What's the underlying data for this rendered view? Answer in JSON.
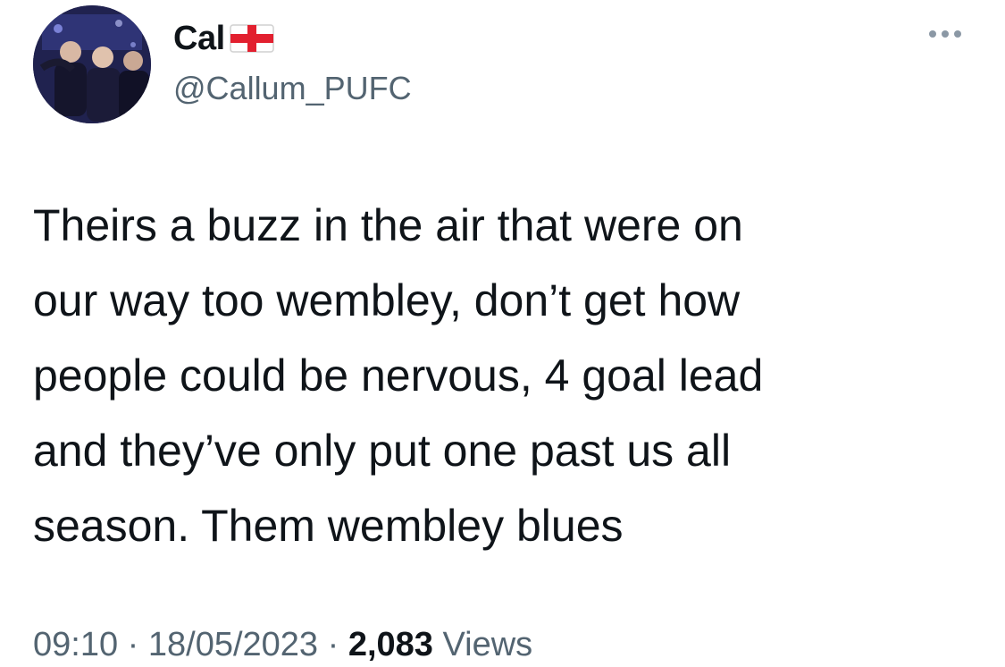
{
  "user": {
    "display_name": "Cal",
    "flag_icon": "england-flag-icon",
    "handle": "@Callum_PUFC"
  },
  "tweet": {
    "lines": [
      "Theirs a buzz in the air that were on",
      "our way too wembley, don’t get how",
      "people could be nervous, 4 goal lead",
      "and they’ve only put one past us all",
      "season. Them wembley blues"
    ]
  },
  "meta": {
    "time": "09:10",
    "separator": " · ",
    "date": "18/05/2023",
    "views_count": "2,083",
    "views_label": "Views"
  },
  "colors": {
    "text": "#0f1419",
    "secondary": "#536471",
    "background": "#ffffff"
  }
}
